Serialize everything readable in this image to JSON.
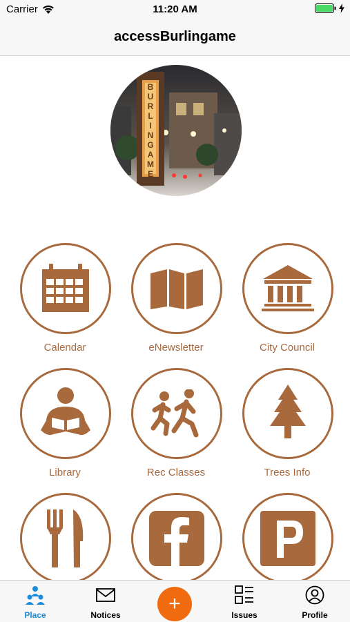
{
  "status_bar": {
    "carrier": "Carrier",
    "time": "11:20 AM"
  },
  "nav": {
    "title": "accessBurlingame"
  },
  "hero": {
    "sign_text": "BURLINGAME"
  },
  "grid": {
    "items": [
      {
        "label": "Calendar",
        "icon": "calendar-icon"
      },
      {
        "label": "eNewsletter",
        "icon": "map-icon"
      },
      {
        "label": "City Council",
        "icon": "city-hall-icon"
      },
      {
        "label": "Library",
        "icon": "reading-person-icon"
      },
      {
        "label": "Rec Classes",
        "icon": "running-kids-icon"
      },
      {
        "label": "Trees Info",
        "icon": "tree-icon"
      },
      {
        "label": "",
        "icon": "fork-knife-icon"
      },
      {
        "label": "",
        "icon": "facebook-icon"
      },
      {
        "label": "",
        "icon": "parking-icon"
      }
    ]
  },
  "tab_bar": {
    "tabs": [
      {
        "label": "Place",
        "icon": "place-icon",
        "active": true
      },
      {
        "label": "Notices",
        "icon": "envelope-icon",
        "active": false
      },
      {
        "label": "",
        "icon": "plus-icon",
        "active": false
      },
      {
        "label": "Issues",
        "icon": "issues-icon",
        "active": false
      },
      {
        "label": "Profile",
        "icon": "profile-icon",
        "active": false
      }
    ],
    "add_symbol": "+"
  },
  "colors": {
    "accent": "#a8693d",
    "active_tab": "#1a8cd8",
    "add_button": "#f06a0f",
    "battery": "#4cd964"
  }
}
